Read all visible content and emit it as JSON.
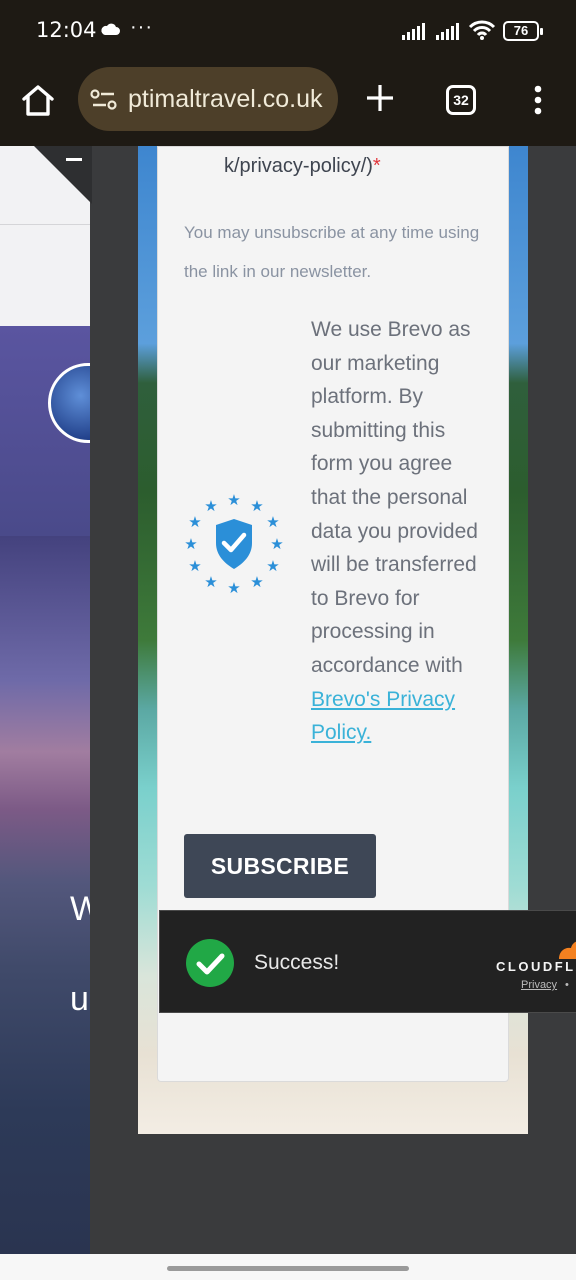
{
  "status_bar": {
    "time": "12:04",
    "more": "···",
    "battery": "76"
  },
  "browser": {
    "url": "ptimaltravel.co.uk",
    "tab_count": "32"
  },
  "background_page": {
    "hero_letter_1": "W",
    "hero_letter_2": "u"
  },
  "form": {
    "privacy_tail": "k/privacy-policy/)",
    "required_mark": "*",
    "unsubscribe_text": "You may unsubscribe at any time using the link in our newsletter.",
    "brevo_text": "We use Brevo as our marketing platform. By submitting this form you agree that the personal data you provided will be transferred to Brevo for processing in accordance with ",
    "brevo_link": "Brevo's Privacy Policy.",
    "subscribe_label": "SUBSCRIBE"
  },
  "cloudflare": {
    "status": "Success!",
    "brand": "CLOUDFLARE",
    "privacy_link": "Privacy",
    "separator": "•"
  },
  "colors": {
    "toolbar_bg": "#1e1a14",
    "url_pill_bg": "#4d3f29",
    "subscribe_bg": "#3e4756",
    "link": "#3ab2d8",
    "success_green": "#21a846",
    "eu_blue": "#2b8fd8"
  }
}
